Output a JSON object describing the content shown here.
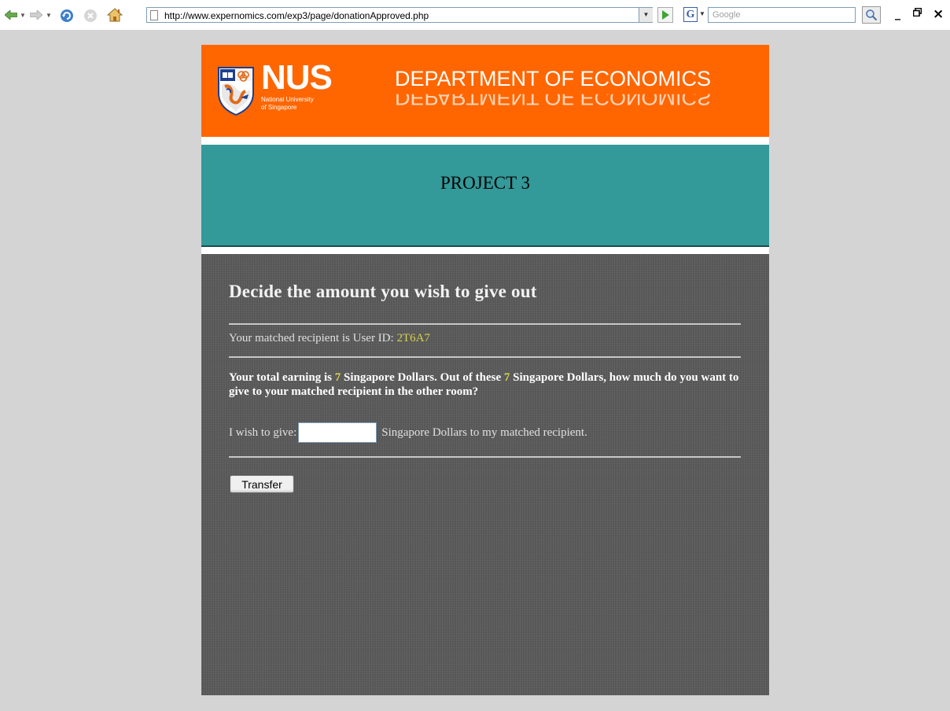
{
  "browser": {
    "url": "http://www.expernomics.com/exp3/page/donationApproved.php",
    "search_placeholder": "Google",
    "search_engine_logo": "G",
    "window_controls": {
      "minimize": "_",
      "restore": "🗗",
      "close": "×"
    }
  },
  "header": {
    "logo_text": "NUS",
    "logo_subtitle_1": "National University",
    "logo_subtitle_2": "of Singapore",
    "department": "DEPARTMENT OF ECONOMICS"
  },
  "project": {
    "title": "PROJECT 3"
  },
  "form": {
    "heading": "Decide the amount you wish to give out",
    "recipient_prefix": "Your matched recipient is User ID: ",
    "recipient_id": "2T6A7",
    "question_part1": "Your total earning is ",
    "earning_1": "7",
    "question_part2": " Singapore Dollars. Out of these ",
    "earning_2": "7",
    "question_part3": " Singapore Dollars, how much do you want to give to your matched recipient in the other room?",
    "give_prefix": "I wish to give:",
    "give_value": "",
    "give_suffix": "Singapore Dollars to my matched recipient.",
    "submit_label": "Transfer"
  },
  "colors": {
    "banner": "#ff6600",
    "teal": "#339999",
    "panel": "#5a5a5a",
    "highlight": "#d8d24a",
    "background": "#d4d4d4"
  }
}
